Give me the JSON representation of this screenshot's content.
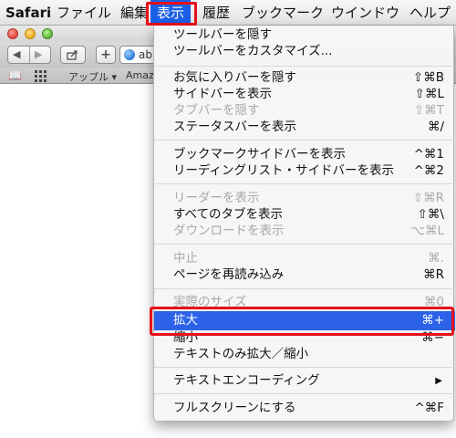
{
  "menubar": {
    "app": "Safari",
    "items": [
      "ファイル",
      "編集",
      "表示",
      "履歴",
      "ブックマーク",
      "ウインドウ",
      "ヘルプ"
    ]
  },
  "toolbar": {
    "url_partial": "ab"
  },
  "bookmarks": {
    "apple": "アップル ▾",
    "amazon": "Amaz"
  },
  "menu": {
    "items": [
      {
        "label": "ツールバーを隠す",
        "shortcut": ""
      },
      {
        "label": "ツールバーをカスタマイズ...",
        "shortcut": ""
      },
      {
        "label": "お気に入りバーを隠す",
        "shortcut": "⇧⌘B"
      },
      {
        "label": "サイドバーを表示",
        "shortcut": "⇧⌘L"
      },
      {
        "label": "タブバーを隠す",
        "shortcut": "⇧⌘T"
      },
      {
        "label": "ステータスバーを表示",
        "shortcut": "⌘/"
      },
      {
        "label": "ブックマークサイドバーを表示",
        "shortcut": "^⌘1"
      },
      {
        "label": "リーディングリスト・サイドバーを表示",
        "shortcut": "^⌘2"
      },
      {
        "label": "リーダーを表示",
        "shortcut": "⇧⌘R"
      },
      {
        "label": "すべてのタブを表示",
        "shortcut": "⇧⌘\\"
      },
      {
        "label": "ダウンロードを表示",
        "shortcut": "⌥⌘L"
      },
      {
        "label": "中止",
        "shortcut": "⌘."
      },
      {
        "label": "ページを再読み込み",
        "shortcut": "⌘R"
      },
      {
        "label": "実際のサイズ",
        "shortcut": "⌘0"
      },
      {
        "label": "拡大",
        "shortcut": "⌘+"
      },
      {
        "label": "縮小",
        "shortcut": "⌘−"
      },
      {
        "label": "テキストのみ拡大／縮小",
        "shortcut": ""
      },
      {
        "label": "テキストエンコーディング",
        "shortcut": "▶"
      },
      {
        "label": "フルスクリーンにする",
        "shortcut": "^⌘F"
      }
    ]
  },
  "colors": {
    "selection": "#2c62e8",
    "highlight_box": "#e8101a",
    "disabled_text": "#a9a9a9"
  }
}
